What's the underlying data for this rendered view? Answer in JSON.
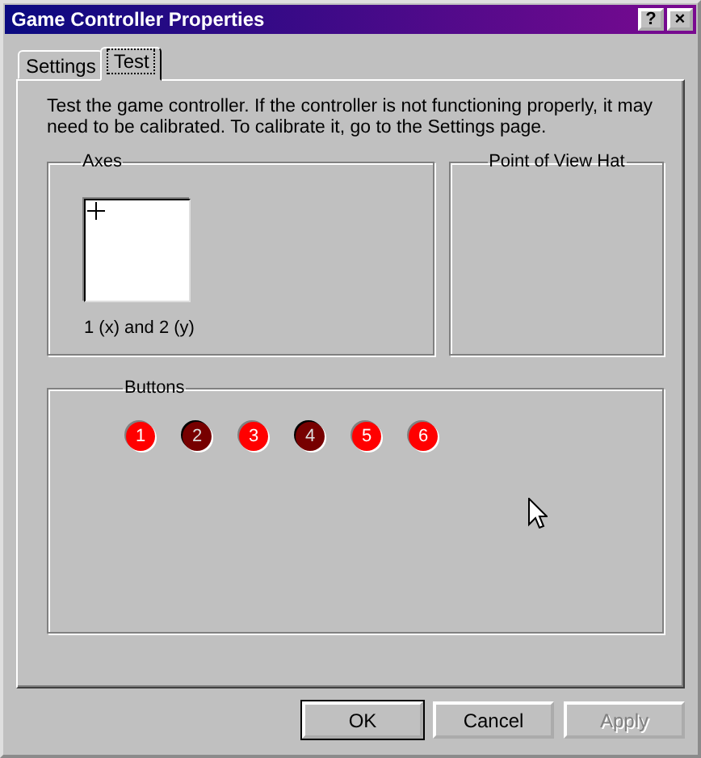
{
  "window": {
    "title": "Game Controller Properties",
    "help": "?",
    "close": "×"
  },
  "tabs": [
    {
      "label": "Settings",
      "selected": false
    },
    {
      "label": "Test",
      "selected": true
    }
  ],
  "intro": "Test the game controller.  If the controller is not functioning properly, it may need to be calibrated.  To calibrate it, go to the Settings page.",
  "axes": {
    "title": "Axes",
    "caption": "1 (x) and 2 (y)"
  },
  "pov": {
    "title": "Point of View Hat"
  },
  "buttons_group": {
    "title": "Buttons",
    "buttons": [
      {
        "label": "1",
        "pressed": false
      },
      {
        "label": "2",
        "pressed": true
      },
      {
        "label": "3",
        "pressed": false
      },
      {
        "label": "4",
        "pressed": true
      },
      {
        "label": "5",
        "pressed": false
      },
      {
        "label": "6",
        "pressed": false
      }
    ]
  },
  "dialog_buttons": [
    {
      "label": "OK",
      "default": true,
      "disabled": false
    },
    {
      "label": "Cancel",
      "default": false,
      "disabled": false
    },
    {
      "label": "Apply",
      "default": false,
      "disabled": true
    }
  ]
}
